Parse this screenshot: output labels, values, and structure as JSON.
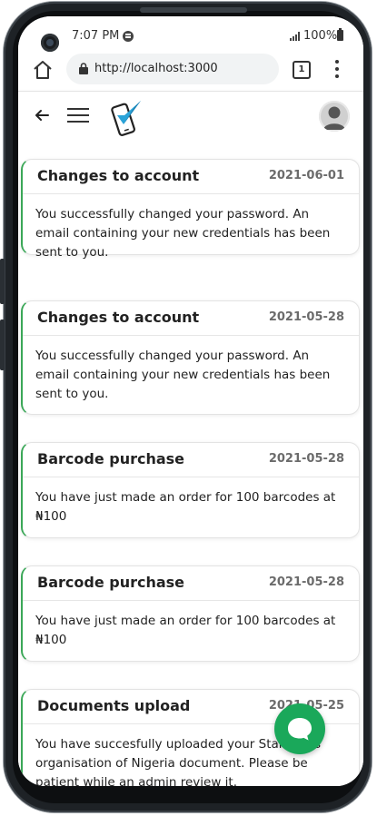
{
  "status_bar": {
    "time": "7:07 PM",
    "battery": "100%"
  },
  "browser": {
    "url": "http://localhost:3000",
    "tab_count": "1"
  },
  "notifications": [
    {
      "title": "Changes to account",
      "date": "2021-06-01",
      "message": "You successfully changed your password. An email containing your new credentials has been sent to you."
    },
    {
      "title": "Changes to account",
      "date": "2021-05-28",
      "message": "You successfully changed your password. An email containing your new credentials has been sent to you."
    },
    {
      "title": "Barcode purchase",
      "date": "2021-05-28",
      "message": "You have just made an order for 100 barcodes at ₦100"
    },
    {
      "title": "Barcode purchase",
      "date": "2021-05-28",
      "message": "You have just made an order for 100 barcodes at ₦100"
    },
    {
      "title": "Documents upload",
      "date": "2021-05-25",
      "message": "You have succesfully uploaded your Standards organisation of Nigeria document. Please be patient while an admin review it."
    }
  ],
  "colors": {
    "accent": "#3aa757",
    "chat_button": "#1aa85a",
    "logo_check": "#2aa3d8"
  },
  "icons": [
    "home-icon",
    "lock-icon",
    "tabs-icon",
    "more-vert-icon",
    "back-arrow-icon",
    "hamburger-menu-icon",
    "phone-check-logo",
    "user-avatar-icon",
    "chat-bubble-icon"
  ]
}
